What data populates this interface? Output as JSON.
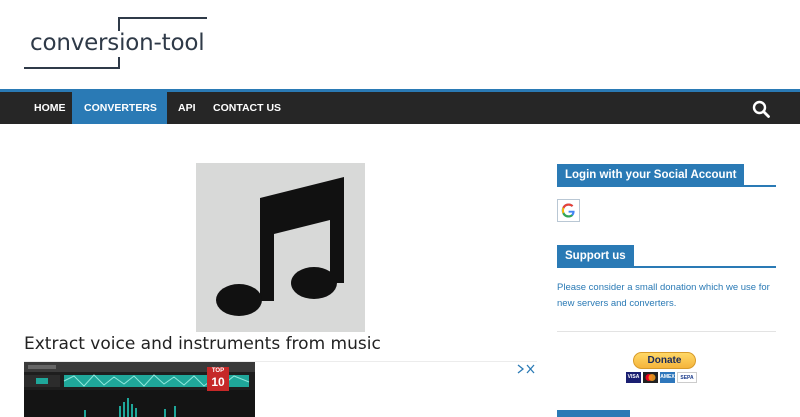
{
  "site": {
    "logo_text": "conversion-tool"
  },
  "nav": {
    "items": [
      {
        "label": "HOME"
      },
      {
        "label": "CONVERTERS"
      },
      {
        "label": "API"
      },
      {
        "label": "CONTACT US"
      }
    ],
    "search_icon": "search-icon"
  },
  "main": {
    "title": "Extract voice and instruments from music",
    "image_icon": "music-note-icon",
    "ad": {
      "badge_top": "TOP",
      "badge_num": "10",
      "close_icon": "ad-choices-icon"
    }
  },
  "sidebar": {
    "login_title": "Login with your Social Account",
    "support_title": "Support us",
    "support_text": "Please consider a small donation which we use for new servers and converters.",
    "donate_label": "Donate",
    "cards": [
      "VISA",
      "MC",
      "AMEX",
      "SEPA"
    ]
  },
  "colors": {
    "accent": "#2a7ab5",
    "nav_bg": "#262626",
    "logo": "#2f3a48"
  }
}
